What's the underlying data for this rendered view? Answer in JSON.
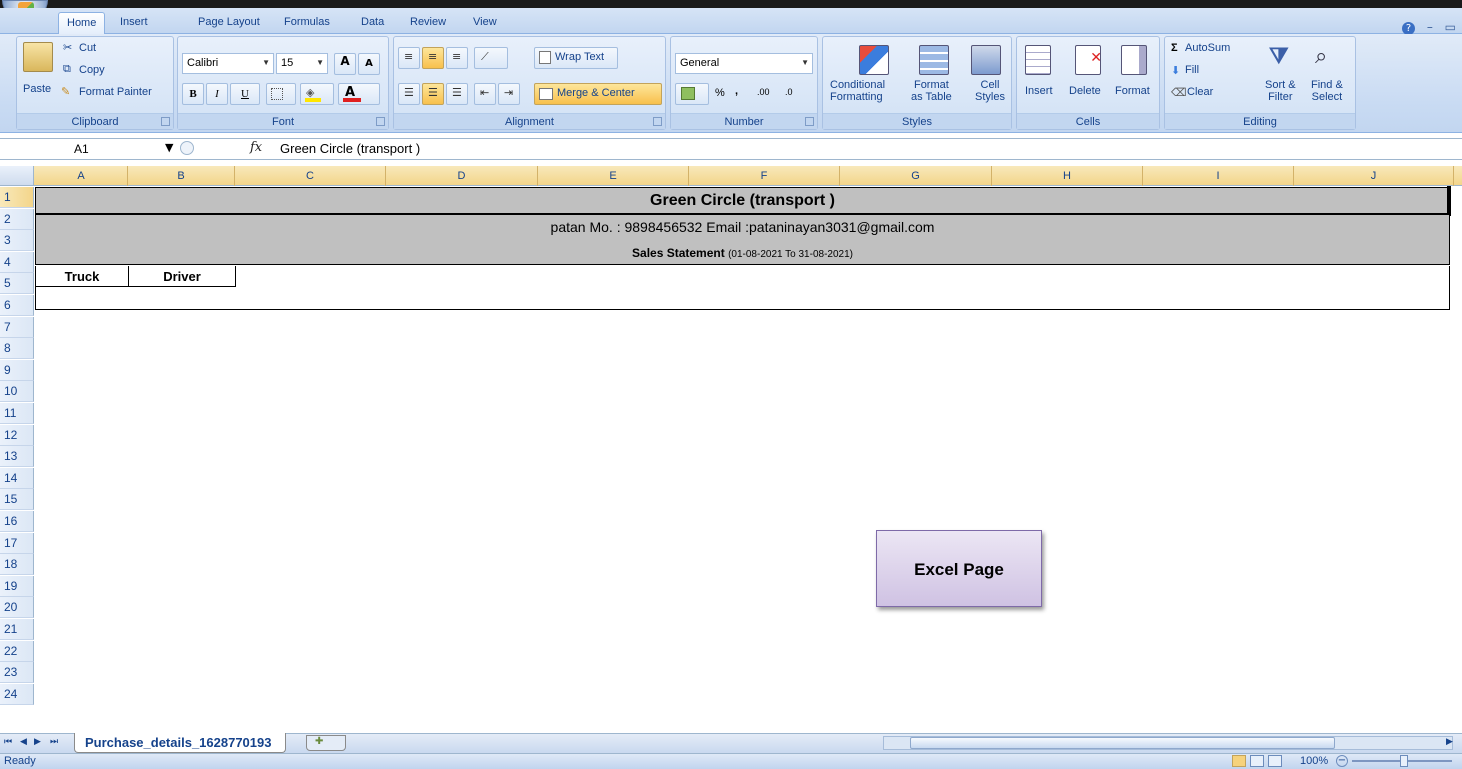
{
  "ribbon_tabs": [
    "Home",
    "Insert",
    "Page Layout",
    "Formulas",
    "Data",
    "Review",
    "View"
  ],
  "window_controls": {
    "help": "?",
    "minimize": "–",
    "restore": "▭"
  },
  "clipboard": {
    "paste": "Paste",
    "cut": "Cut",
    "copy": "Copy",
    "format_painter": "Format Painter",
    "label": "Clipboard"
  },
  "font": {
    "name": "Calibri",
    "size": "15",
    "bold": "B",
    "italic": "I",
    "underline": "U",
    "grow": "A",
    "shrink": "A",
    "label": "Font",
    "font_color": "#e02020",
    "fill_color": "#ffe600"
  },
  "alignment": {
    "wrap_text": "Wrap Text",
    "merge_center": "Merge & Center",
    "label": "Alignment"
  },
  "number": {
    "format": "General",
    "percent": "%",
    "comma": ",",
    "inc_dec": ".00",
    "dec_dec": ".0",
    "label": "Number"
  },
  "styles": {
    "conditional": [
      "Conditional",
      "Formatting"
    ],
    "format_table": [
      "Format",
      "as Table"
    ],
    "cell_styles": [
      "Cell",
      "Styles"
    ],
    "label": "Styles"
  },
  "cells": {
    "insert": "Insert",
    "delete": "Delete",
    "format": "Format",
    "label": "Cells"
  },
  "editing": {
    "autosum": "AutoSum",
    "fill": "Fill",
    "clear": "Clear",
    "sort_filter": [
      "Sort &",
      "Filter"
    ],
    "find_select": [
      "Find &",
      "Select"
    ],
    "label": "Editing"
  },
  "formula_bar": {
    "name_box": "A1",
    "fx": "fx",
    "formula": "Green Circle  (transport )"
  },
  "columns": [
    "A",
    "B",
    "C",
    "D",
    "E",
    "F",
    "G",
    "H",
    "I",
    "J"
  ],
  "rows": [
    "1",
    "2",
    "3",
    "4",
    "5",
    "6",
    "7",
    "8",
    "9",
    "10",
    "11",
    "12",
    "13",
    "14",
    "15",
    "16",
    "17",
    "18",
    "19",
    "20",
    "21",
    "22",
    "23",
    "24"
  ],
  "sheet": {
    "title": "Green Circle  (transport )",
    "contact": "patan Mo. : 9898456532 Email :pataninayan3031@gmail.com",
    "statement_label": "Sales Statement",
    "statement_range": "(01-08-2021 To 31-08-2021)",
    "headers": [
      "Truck",
      "Driver"
    ]
  },
  "callout": "Excel Page",
  "sheet_tab": "Purchase_details_1628770193",
  "status": {
    "ready": "Ready",
    "zoom": "100%"
  }
}
